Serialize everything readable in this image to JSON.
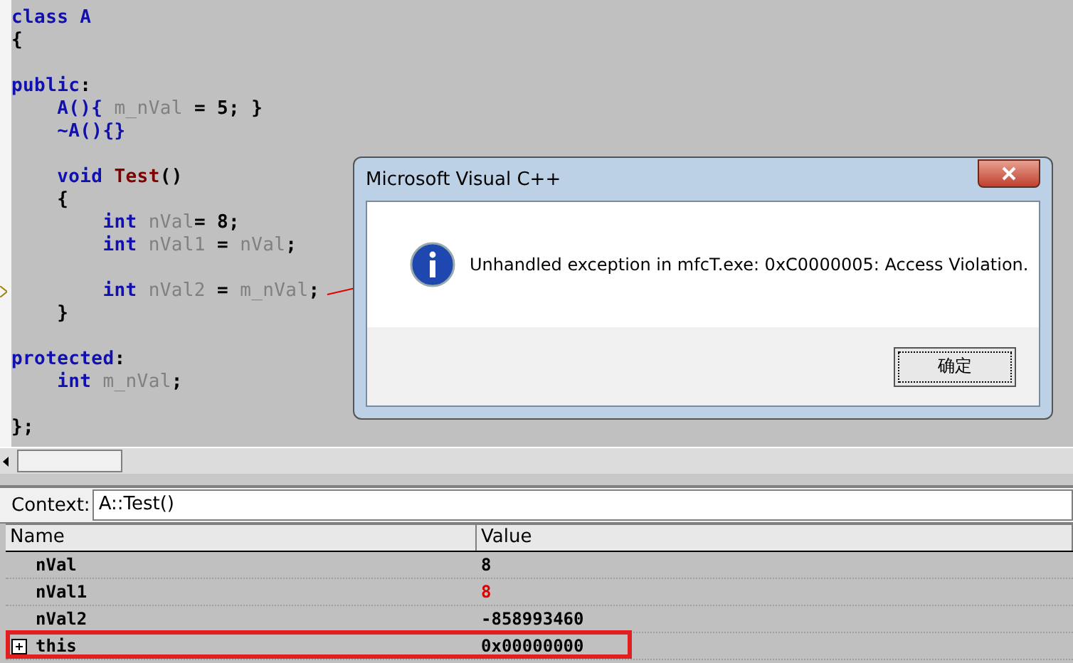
{
  "editor": {
    "lines": [
      {
        "kind": "code",
        "current": false,
        "tokens": [
          {
            "kind": "keyword",
            "text": "class A"
          }
        ]
      },
      {
        "kind": "code",
        "current": false,
        "tokens": [
          {
            "kind": "plain",
            "text": "{"
          }
        ]
      },
      {
        "kind": "blank"
      },
      {
        "kind": "code",
        "current": false,
        "tokens": [
          {
            "kind": "keyword",
            "text": "public"
          },
          {
            "kind": "plain",
            "text": ":"
          }
        ]
      },
      {
        "kind": "code",
        "current": false,
        "tokens": [
          {
            "kind": "keyword",
            "text": "    A(){ "
          },
          {
            "kind": "name",
            "text": "m_nVal"
          },
          {
            "kind": "plain",
            "text": " = 5; }"
          }
        ]
      },
      {
        "kind": "code",
        "current": false,
        "tokens": [
          {
            "kind": "keyword",
            "text": "    ~A(){}"
          }
        ]
      },
      {
        "kind": "blank"
      },
      {
        "kind": "code",
        "current": false,
        "tokens": [
          {
            "kind": "keyword",
            "text": "    void "
          },
          {
            "kind": "func",
            "text": "Test"
          },
          {
            "kind": "plain",
            "text": "()"
          }
        ]
      },
      {
        "kind": "code",
        "current": false,
        "tokens": [
          {
            "kind": "plain",
            "text": "    {"
          }
        ]
      },
      {
        "kind": "code",
        "current": false,
        "tokens": [
          {
            "kind": "keyword",
            "text": "        int "
          },
          {
            "kind": "name",
            "text": "nVal"
          },
          {
            "kind": "plain",
            "text": "= 8;"
          }
        ]
      },
      {
        "kind": "code",
        "current": false,
        "tokens": [
          {
            "kind": "keyword",
            "text": "        int "
          },
          {
            "kind": "name",
            "text": "nVal1"
          },
          {
            "kind": "plain",
            "text": " = "
          },
          {
            "kind": "name",
            "text": "nVal"
          },
          {
            "kind": "plain",
            "text": ";"
          }
        ]
      },
      {
        "kind": "blank"
      },
      {
        "kind": "code",
        "current": true,
        "tokens": [
          {
            "kind": "keyword",
            "text": "        int "
          },
          {
            "kind": "name",
            "text": "nVal2"
          },
          {
            "kind": "plain",
            "text": " = "
          },
          {
            "kind": "name",
            "text": "m_nVal"
          },
          {
            "kind": "plain",
            "text": ";"
          }
        ]
      },
      {
        "kind": "code",
        "current": false,
        "tokens": [
          {
            "kind": "plain",
            "text": "    }"
          }
        ]
      },
      {
        "kind": "blank"
      },
      {
        "kind": "code",
        "current": false,
        "tokens": [
          {
            "kind": "keyword",
            "text": "protected"
          },
          {
            "kind": "plain",
            "text": ":"
          }
        ]
      },
      {
        "kind": "code",
        "current": false,
        "tokens": [
          {
            "kind": "keyword",
            "text": "    int "
          },
          {
            "kind": "name",
            "text": "m_nVal"
          },
          {
            "kind": "plain",
            "text": ";"
          }
        ]
      },
      {
        "kind": "blank"
      },
      {
        "kind": "code",
        "current": false,
        "tokens": [
          {
            "kind": "plain",
            "text": "};"
          }
        ]
      }
    ]
  },
  "dialog": {
    "title": "Microsoft Visual C++",
    "message": "Unhandled exception in mfcT.exe: 0xC0000005: Access Violation.",
    "button": "确定"
  },
  "context": {
    "label": "Context:",
    "value": "A::Test()"
  },
  "variables": {
    "columns": [
      "Name",
      "Value"
    ],
    "rows": [
      {
        "name": "nVal",
        "value": "8",
        "changed": false,
        "expandable": false,
        "highlighted": false
      },
      {
        "name": "nVal1",
        "value": "8",
        "changed": true,
        "expandable": false,
        "highlighted": false
      },
      {
        "name": "nVal2",
        "value": "-858993460",
        "changed": false,
        "expandable": false,
        "highlighted": false
      },
      {
        "name": "this",
        "value": "0x00000000",
        "changed": false,
        "expandable": true,
        "highlighted": true
      }
    ]
  }
}
